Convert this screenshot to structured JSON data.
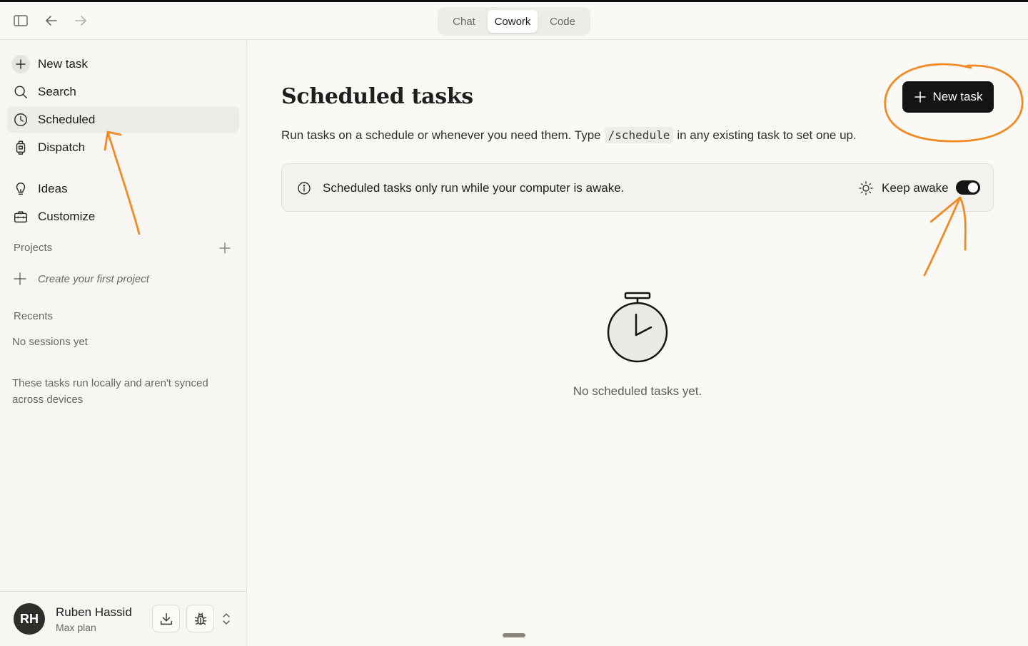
{
  "titlebar": {
    "modes": [
      {
        "label": "Chat",
        "active": false
      },
      {
        "label": "Cowork",
        "active": true
      },
      {
        "label": "Code",
        "active": false
      }
    ]
  },
  "sidebar": {
    "items": [
      {
        "label": "New task",
        "icon": "plus-icon"
      },
      {
        "label": "Search",
        "icon": "search-icon"
      },
      {
        "label": "Scheduled",
        "icon": "clock-icon",
        "active": true
      },
      {
        "label": "Dispatch",
        "icon": "watch-icon"
      },
      {
        "label": "Ideas",
        "icon": "lightbulb-icon"
      },
      {
        "label": "Customize",
        "icon": "briefcase-icon"
      }
    ],
    "projects_label": "Projects",
    "create_project": "Create your first project",
    "recents_label": "Recents",
    "no_sessions": "No sessions yet",
    "local_note": "These tasks run locally and aren't synced across devices"
  },
  "user": {
    "initials": "RH",
    "name": "Ruben Hassid",
    "plan": "Max plan"
  },
  "main": {
    "title": "Scheduled tasks",
    "new_task_label": "New task",
    "desc_before": "Run tasks on a schedule or whenever you need them. Type",
    "desc_code": "/schedule",
    "desc_after": "in any existing task to set one up.",
    "notice": "Scheduled tasks only run while your computer is awake.",
    "keep_awake_label": "Keep awake",
    "keep_awake_on": true,
    "empty_text": "No scheduled tasks yet."
  },
  "colors": {
    "annotation": "#f28a24",
    "primary_button": "#141413",
    "background": "#faf9f5"
  }
}
